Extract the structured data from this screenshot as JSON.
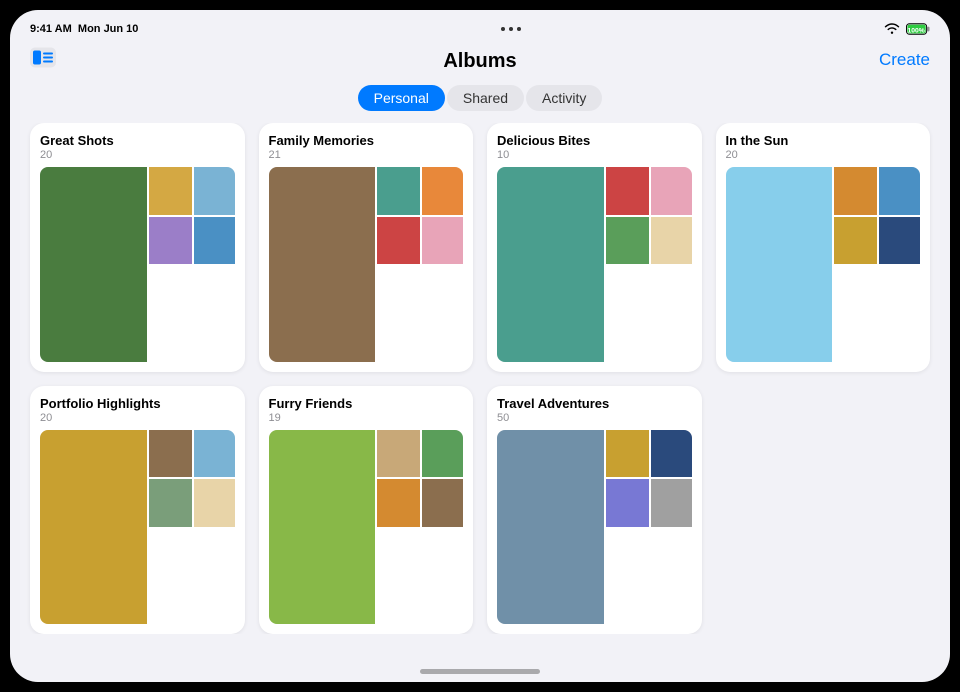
{
  "statusBar": {
    "time": "9:41 AM",
    "date": "Mon Jun 10",
    "battery": "100%"
  },
  "header": {
    "title": "Albums",
    "createLabel": "Create",
    "sidebarAriaLabel": "Sidebar toggle"
  },
  "tabs": [
    {
      "label": "Personal",
      "active": true
    },
    {
      "label": "Shared",
      "active": false
    },
    {
      "label": "Activity",
      "active": false
    }
  ],
  "albums": [
    {
      "title": "Great Shots",
      "count": "20",
      "colors": [
        "c-green",
        "c-yellow",
        "c-blue-light",
        "c-purple",
        "c-blue",
        "c-orange"
      ]
    },
    {
      "title": "Family Memories",
      "count": "21",
      "colors": [
        "c-brown",
        "c-teal",
        "c-orange",
        "c-red",
        "c-pink",
        "c-tan"
      ]
    },
    {
      "title": "Delicious Bites",
      "count": "10",
      "colors": [
        "c-teal",
        "c-red",
        "c-pink",
        "c-green2",
        "c-cream",
        "c-lime"
      ]
    },
    {
      "title": "In the Sun",
      "count": "20",
      "colors": [
        "c-sky",
        "c-amber",
        "c-blue",
        "c-mustard",
        "c-navy",
        "c-steel"
      ]
    },
    {
      "title": "Portfolio Highlights",
      "count": "20",
      "colors": [
        "c-mustard",
        "c-brown",
        "c-blue-light",
        "c-sage",
        "c-cream",
        "c-forest"
      ]
    },
    {
      "title": "Furry Friends",
      "count": "19",
      "colors": [
        "c-lime",
        "c-tan",
        "c-green2",
        "c-amber",
        "c-brown",
        "c-sage"
      ]
    },
    {
      "title": "Travel Adventures",
      "count": "50",
      "colors": [
        "c-steel",
        "c-mustard",
        "c-navy",
        "c-periwinkle",
        "c-gray",
        "c-amber"
      ]
    }
  ]
}
